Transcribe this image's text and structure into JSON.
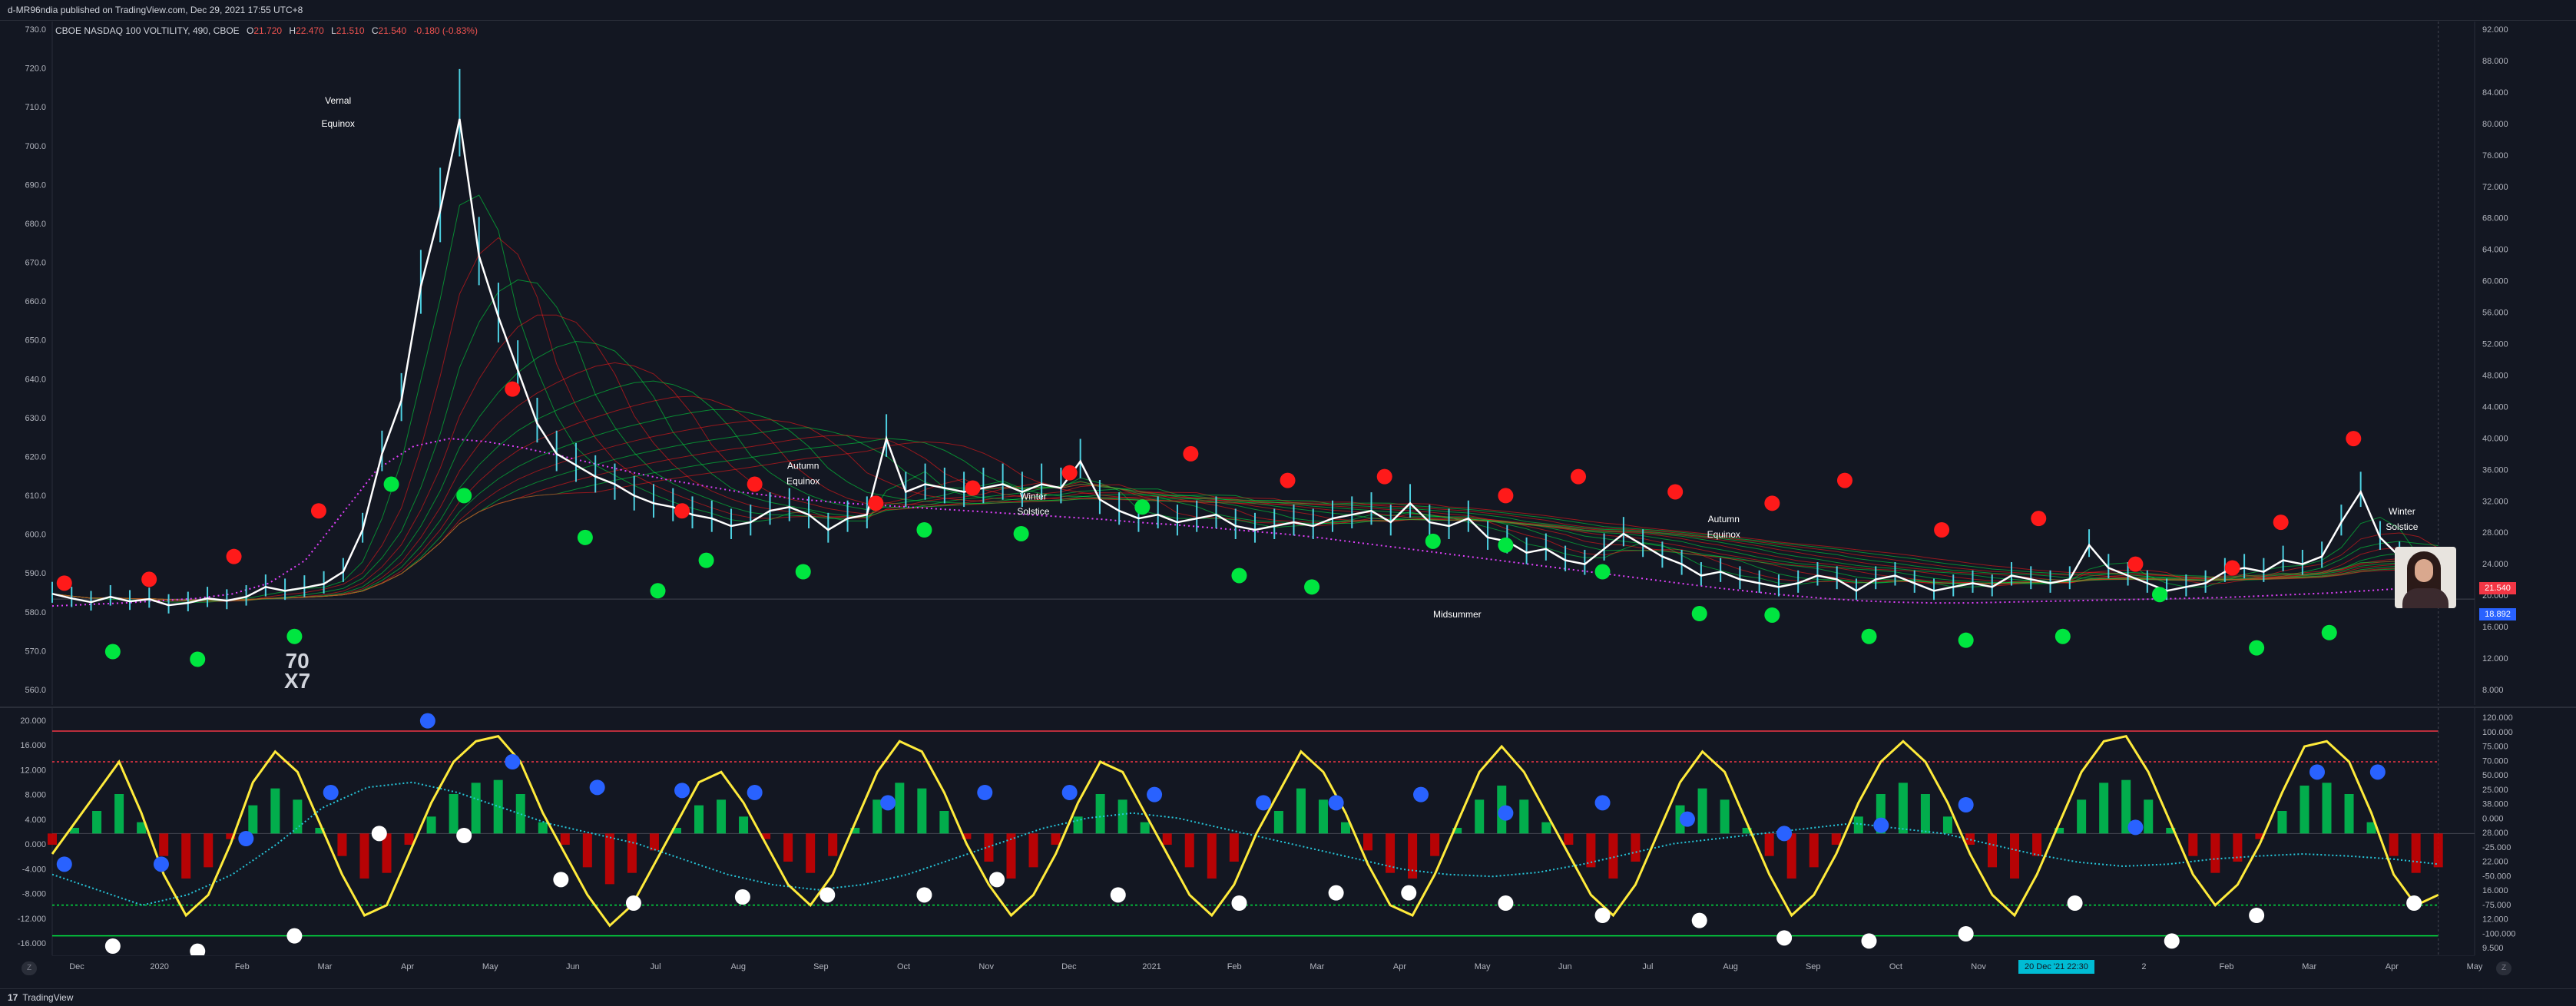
{
  "header": {
    "published": "d-MR96ndia published on TradingView.com, Dec 29, 2021 17:55 UTC+8"
  },
  "legend": {
    "symbol": "CBOE NASDAQ 100 VOLTILITY, 490, CBOE",
    "o_label": "O",
    "o_value": "21.720",
    "h_label": "H",
    "h_value": "22.470",
    "l_label": "L",
    "l_value": "21.510",
    "c_label": "C",
    "c_value": "21.540",
    "change": "-0.180 (-0.83%)"
  },
  "price_tags": {
    "last": "21.540",
    "secondary": "18.892"
  },
  "time_cursor": "20 Dec '21   22:30",
  "watermark": {
    "line1": "70",
    "line2": "X7"
  },
  "annotations": [
    {
      "text": "Vernal"
    },
    {
      "text": "Equinox"
    },
    {
      "text": "Autumn"
    },
    {
      "text": "Equinox"
    },
    {
      "text": "Winter"
    },
    {
      "text": "Solstice"
    },
    {
      "text": "Autumn"
    },
    {
      "text": "Equinox"
    },
    {
      "text": "Winter"
    },
    {
      "text": "Solstice"
    },
    {
      "text": "Midsummer"
    }
  ],
  "footer": {
    "brand_mark": "17",
    "brand_name": "TradingView",
    "scale_left": "Z",
    "scale_right": "Z"
  },
  "colors": {
    "background": "#131722",
    "bull_dot": "#00e640",
    "bear_dot": "#ff1a1a",
    "blue_dot": "#2962ff",
    "white_dot": "#ffffff",
    "oscillator": "#ffeb3b",
    "cyan_line": "#26c6da",
    "price_line": "#ffffff"
  },
  "chart_data": [
    {
      "type": "line",
      "title": "CBOE NASDAQ 100 VOLTILITY, 490, CBOE",
      "x_tick_labels": [
        "Dec",
        "2020",
        "Feb",
        "Mar",
        "Apr",
        "May",
        "Jun",
        "Jul",
        "Aug",
        "Sep",
        "Oct",
        "Nov",
        "Dec",
        "2021",
        "Feb",
        "Mar",
        "Apr",
        "May",
        "Jun",
        "Jul",
        "Aug",
        "Sep",
        "Oct",
        "Nov",
        "Dec",
        "2",
        "Feb",
        "Mar",
        "Apr",
        "May"
      ],
      "left_axis_ticks": [
        "730.0",
        "720.0",
        "710.0",
        "700.0",
        "690.0",
        "680.0",
        "670.0",
        "660.0",
        "650.0",
        "640.0",
        "630.0",
        "620.0",
        "610.0",
        "600.0",
        "590.0",
        "580.0",
        "570.0",
        "560.0"
      ],
      "right_axis_ticks": [
        "92.000",
        "88.000",
        "84.000",
        "80.000",
        "76.000",
        "72.000",
        "68.000",
        "64.000",
        "60.000",
        "56.000",
        "52.000",
        "48.000",
        "44.000",
        "40.000",
        "36.000",
        "32.000",
        "28.000",
        "24.000",
        "20.000",
        "16.000",
        "12.000",
        "8.000"
      ],
      "ylim_right": [
        6,
        94
      ],
      "series": [
        {
          "values": [
            19.6,
            19.0,
            18.5,
            19.2,
            18.6,
            18.9,
            18.1,
            18.4,
            19.0,
            18.7,
            19.2,
            20.5,
            20.0,
            20.4,
            20.9,
            22.5,
            28.0,
            38.0,
            45.0,
            60.0,
            70.0,
            82.0,
            64.0,
            56.0,
            49.0,
            42.0,
            38.0,
            36.5,
            35.0,
            34.0,
            32.5,
            31.5,
            31.0,
            30.0,
            29.5,
            28.5,
            29.0,
            30.5,
            31.0,
            30.0,
            28.0,
            29.5,
            30.0,
            40.0,
            33.0,
            34.0,
            33.5,
            33.0,
            33.5,
            34.0,
            33.0,
            34.0,
            33.5,
            37.0,
            32.0,
            30.5,
            29.5,
            30.0,
            29.0,
            29.5,
            30.0,
            28.5,
            28.0,
            28.5,
            29.0,
            28.5,
            29.5,
            30.0,
            30.5,
            29.0,
            31.5,
            29.0,
            28.5,
            29.5,
            27.0,
            26.5,
            25.0,
            25.5,
            24.0,
            23.5,
            25.5,
            27.5,
            26.0,
            24.5,
            23.5,
            22.0,
            22.5,
            21.5,
            21.0,
            20.5,
            21.0,
            22.0,
            21.5,
            20.0,
            21.5,
            22.0,
            21.0,
            20.0,
            20.5,
            21.0,
            20.5,
            22.0,
            21.5,
            21.0,
            21.5,
            26.0,
            23.0,
            22.0,
            21.0,
            20.0,
            20.5,
            21.0,
            22.5,
            23.0,
            22.5,
            24.0,
            23.5,
            24.5,
            29.0,
            33.0,
            27.0,
            24.5,
            22.0,
            21.5
          ]
        },
        {
          "values": [
            18.0,
            18.2,
            18.4,
            18.7,
            19.0,
            19.6,
            21.0,
            24.0,
            30.0,
            36.0,
            39.0,
            40.0,
            39.6,
            38.8,
            37.8,
            36.7,
            35.6,
            34.6,
            33.8,
            33.0,
            32.4,
            31.9,
            31.5,
            31.2,
            30.9,
            30.6,
            30.3,
            30.0,
            29.7,
            29.4,
            29.0,
            28.7,
            28.3,
            27.9,
            27.5,
            27.0,
            26.4,
            25.8,
            25.2,
            24.6,
            24.0,
            23.4,
            22.8,
            22.2,
            21.6,
            21.0,
            20.4,
            19.9,
            19.4,
            19.0,
            18.7,
            18.5,
            18.4,
            18.4,
            18.5,
            18.6,
            18.7,
            18.8,
            18.9,
            19.0,
            19.1,
            19.3,
            19.5,
            19.7,
            20.0,
            20.3,
            20.6
          ]
        }
      ],
      "markers": {
        "red_dots": [
          [
            0.005,
            21.0
          ],
          [
            0.04,
            21.5
          ],
          [
            0.075,
            24.5
          ],
          [
            0.11,
            30.5
          ],
          [
            0.19,
            46.5
          ],
          [
            0.26,
            30.5
          ],
          [
            0.29,
            34.0
          ],
          [
            0.34,
            31.5
          ],
          [
            0.38,
            33.5
          ],
          [
            0.42,
            35.5
          ],
          [
            0.47,
            38.0
          ],
          [
            0.51,
            34.5
          ],
          [
            0.55,
            35.0
          ],
          [
            0.6,
            32.5
          ],
          [
            0.63,
            35.0
          ],
          [
            0.67,
            33.0
          ],
          [
            0.71,
            31.5
          ],
          [
            0.74,
            34.5
          ],
          [
            0.78,
            28.0
          ],
          [
            0.82,
            29.5
          ],
          [
            0.86,
            23.5
          ],
          [
            0.9,
            23.0
          ],
          [
            0.92,
            29.0
          ],
          [
            0.95,
            40.0
          ]
        ],
        "green_dots": [
          [
            0.025,
            12.0
          ],
          [
            0.06,
            11.0
          ],
          [
            0.1,
            14.0
          ],
          [
            0.14,
            34.0
          ],
          [
            0.17,
            32.5
          ],
          [
            0.22,
            27.0
          ],
          [
            0.25,
            20.0
          ],
          [
            0.27,
            24.0
          ],
          [
            0.31,
            22.5
          ],
          [
            0.36,
            28.0
          ],
          [
            0.4,
            27.5
          ],
          [
            0.45,
            31.0
          ],
          [
            0.49,
            22.0
          ],
          [
            0.52,
            20.5
          ],
          [
            0.57,
            26.5
          ],
          [
            0.6,
            26.0
          ],
          [
            0.64,
            22.5
          ],
          [
            0.68,
            17.0
          ],
          [
            0.71,
            16.8
          ],
          [
            0.75,
            14.0
          ],
          [
            0.79,
            13.5
          ],
          [
            0.83,
            14.0
          ],
          [
            0.87,
            19.5
          ],
          [
            0.91,
            12.5
          ],
          [
            0.94,
            14.5
          ],
          [
            0.975,
            23.0
          ]
        ]
      }
    },
    {
      "type": "line",
      "title": "",
      "left_axis_ticks": [
        "20.000",
        "16.000",
        "12.000",
        "8.000",
        "4.000",
        "0.000",
        "-4.000",
        "-8.000",
        "-12.000",
        "-16.000"
      ],
      "right_axis_ticks": [
        "120.000",
        "100.000",
        "75.000",
        "70.000",
        "50.000",
        "25.000",
        "38.000",
        "0.000",
        "28.000",
        "-25.000",
        "22.000",
        "-50.000",
        "16.000",
        "-75.000",
        "12.000",
        "-100.000",
        "9.500"
      ],
      "ylim": [
        -110,
        115
      ],
      "series": [
        {
          "values": [
            -20,
            10,
            40,
            70,
            20,
            -40,
            -80,
            -60,
            -10,
            50,
            80,
            60,
            10,
            -40,
            -80,
            -70,
            -20,
            30,
            70,
            90,
            95,
            70,
            20,
            -20,
            -60,
            -90,
            -70,
            -30,
            10,
            50,
            60,
            30,
            -10,
            -50,
            -70,
            -40,
            10,
            60,
            90,
            80,
            40,
            -10,
            -50,
            -80,
            -60,
            -20,
            30,
            70,
            60,
            20,
            -20,
            -60,
            -80,
            -50,
            0,
            40,
            80,
            60,
            20,
            -30,
            -70,
            -80,
            -40,
            10,
            60,
            85,
            60,
            20,
            -20,
            -60,
            -80,
            -50,
            0,
            50,
            80,
            60,
            10,
            -40,
            -80,
            -60,
            -20,
            30,
            70,
            90,
            70,
            30,
            -20,
            -60,
            -80,
            -40,
            10,
            60,
            90,
            95,
            60,
            10,
            -40,
            -70,
            -50,
            -10,
            40,
            85,
            90,
            70,
            20,
            -40,
            -70,
            -60
          ]
        },
        {
          "values": [
            -40,
            -55,
            -70,
            -60,
            -40,
            -10,
            25,
            45,
            50,
            40,
            25,
            10,
            0,
            -10,
            -25,
            -40,
            -50,
            -55,
            -50,
            -40,
            -25,
            -10,
            5,
            15,
            20,
            15,
            5,
            -5,
            -15,
            -25,
            -35,
            -40,
            -42,
            -38,
            -30,
            -20,
            -10,
            -5,
            0,
            5,
            10,
            5,
            0,
            -10,
            -20,
            -28,
            -32,
            -30,
            -25,
            -22,
            -20,
            -22,
            -25,
            -30
          ]
        }
      ],
      "dots": {
        "blue": [
          [
            0.005,
            -30
          ],
          [
            0.045,
            -30
          ],
          [
            0.08,
            -5
          ],
          [
            0.115,
            40
          ],
          [
            0.155,
            110
          ],
          [
            0.19,
            70
          ],
          [
            0.225,
            45
          ],
          [
            0.26,
            42
          ],
          [
            0.29,
            40
          ],
          [
            0.345,
            30
          ],
          [
            0.385,
            40
          ],
          [
            0.42,
            40
          ],
          [
            0.455,
            38
          ],
          [
            0.5,
            30
          ],
          [
            0.53,
            30
          ],
          [
            0.565,
            38
          ],
          [
            0.6,
            20
          ],
          [
            0.64,
            30
          ],
          [
            0.675,
            14
          ],
          [
            0.715,
            0
          ],
          [
            0.755,
            8
          ],
          [
            0.79,
            28
          ],
          [
            0.86,
            6
          ],
          [
            0.935,
            60
          ],
          [
            0.96,
            60
          ]
        ],
        "white": [
          [
            0.025,
            -110
          ],
          [
            0.06,
            -115
          ],
          [
            0.1,
            -100
          ],
          [
            0.135,
            0
          ],
          [
            0.17,
            -2
          ],
          [
            0.21,
            -45
          ],
          [
            0.24,
            -68
          ],
          [
            0.285,
            -62
          ],
          [
            0.32,
            -60
          ],
          [
            0.36,
            -60
          ],
          [
            0.39,
            -45
          ],
          [
            0.44,
            -60
          ],
          [
            0.49,
            -68
          ],
          [
            0.53,
            -58
          ],
          [
            0.56,
            -58
          ],
          [
            0.6,
            -68
          ],
          [
            0.64,
            -80
          ],
          [
            0.68,
            -85
          ],
          [
            0.715,
            -102
          ],
          [
            0.75,
            -105
          ],
          [
            0.79,
            -98
          ],
          [
            0.835,
            -68
          ],
          [
            0.875,
            -105
          ],
          [
            0.91,
            -80
          ],
          [
            0.975,
            -68
          ]
        ]
      }
    }
  ]
}
